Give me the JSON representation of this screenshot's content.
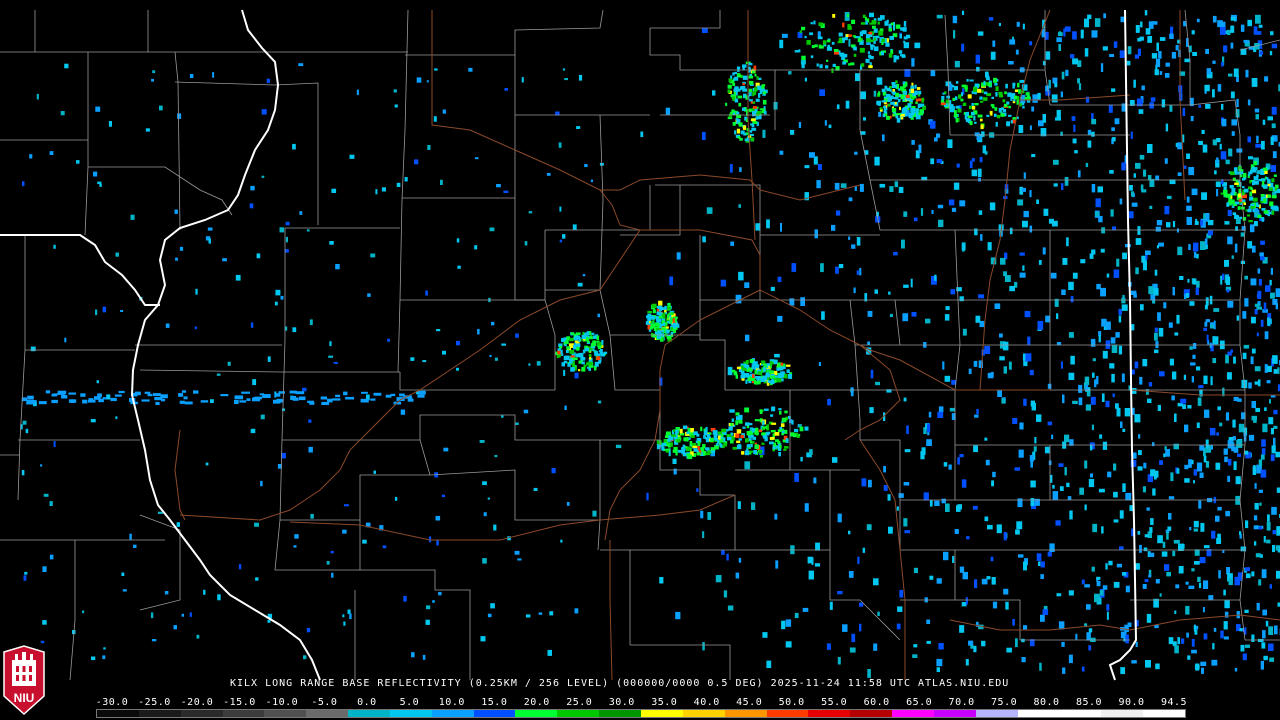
{
  "product": {
    "caption": "KILX LONG RANGE BASE REFLECTIVITY (0.25KM / 256 LEVEL) (000000/0000 0.5 DEG) 2025-11-24 11:58 UTC  ATLAS.NIU.EDU"
  },
  "logo": {
    "text": "NIU",
    "icon": "niu-tower-logo-icon",
    "color": "#c8102e"
  },
  "scale": {
    "labels": [
      "-30.0",
      "-25.0",
      "-20.0",
      "-15.0",
      "-10.0",
      "-5.0",
      "0.0",
      "5.0",
      "10.0",
      "15.0",
      "20.0",
      "25.0",
      "30.0",
      "35.0",
      "40.0",
      "45.0",
      "50.0",
      "55.0",
      "60.0",
      "65.0",
      "70.0",
      "75.0",
      "80.0",
      "85.0",
      "90.0",
      "94.5"
    ],
    "colors": [
      "#0a0a0a",
      "#1a1a1a",
      "#2a2a2a",
      "#3c3c3c",
      "#505050",
      "#6a6a6a",
      "#00b4c8",
      "#00c8f0",
      "#0aa0ff",
      "#0050ff",
      "#00ff32",
      "#00c800",
      "#009600",
      "#ffff00",
      "#ffd200",
      "#ff9600",
      "#ff3c00",
      "#e60000",
      "#b40000",
      "#ff00ff",
      "#c800ff",
      "#b4b4ff",
      "#ffffff",
      "#ffffff",
      "#f0f0f0",
      "#ffffff"
    ]
  },
  "map_colors": {
    "county_lines": "#9a9a9a",
    "state_lines": "#ffffff",
    "highways": "#8b4a2a",
    "background": "#000000"
  }
}
